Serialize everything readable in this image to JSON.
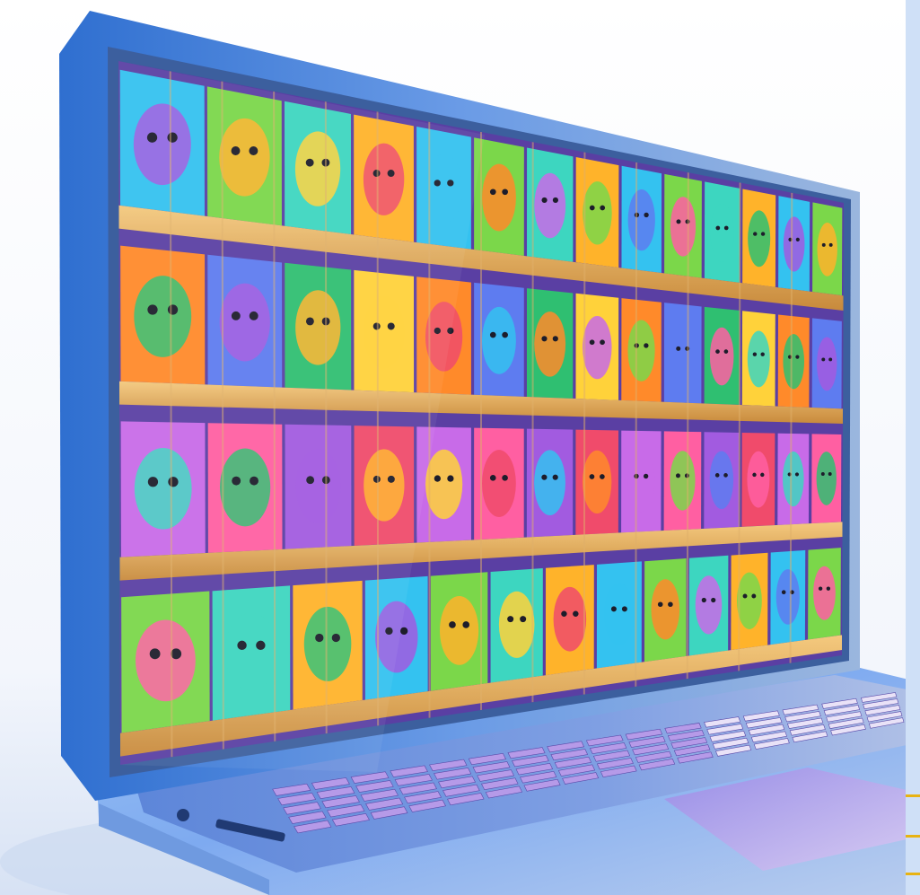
{
  "scene": {
    "subject": "laptop",
    "colors": {
      "frame_blue": "#3f7fd6",
      "shelf_wood": "#d8a052",
      "keyboard_lilac": "#b69ae8",
      "backdrop": "#f2f5fb",
      "accent_gold": "#e8b313"
    }
  }
}
